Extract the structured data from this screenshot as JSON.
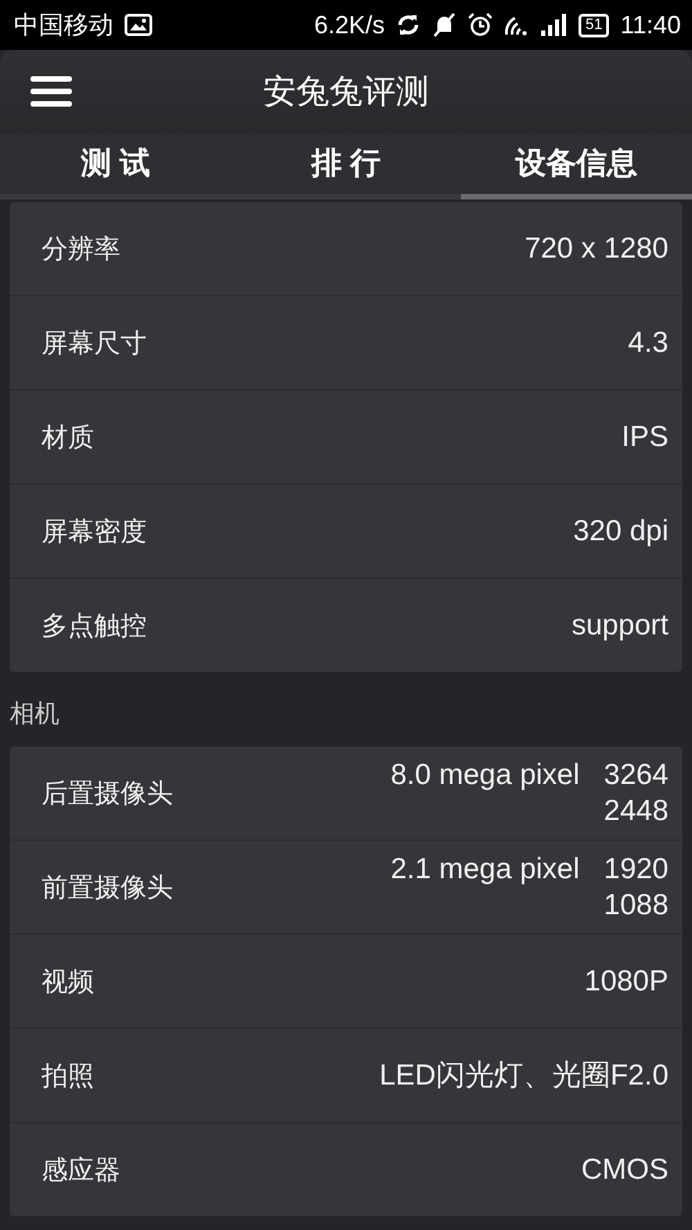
{
  "status_bar": {
    "carrier": "中国移动",
    "speed": "6.2K/s",
    "battery": "51",
    "time": "11:40"
  },
  "app_bar": {
    "title": "安兔兔评测"
  },
  "tabs": [
    {
      "label": "测 试",
      "selected": false
    },
    {
      "label": "排 行",
      "selected": false
    },
    {
      "label": "设备信息",
      "selected": true
    }
  ],
  "sections": [
    {
      "rows": [
        {
          "label": "分辨率",
          "value_lines": [
            "720 x 1280"
          ]
        },
        {
          "label": "屏幕尺寸",
          "value_lines": [
            "4.3"
          ]
        },
        {
          "label": "材质",
          "value_lines": [
            "IPS"
          ]
        },
        {
          "label": "屏幕密度",
          "value_lines": [
            "320 dpi"
          ]
        },
        {
          "label": "多点触控",
          "value_lines": [
            "support"
          ]
        }
      ]
    },
    {
      "heading": "相机",
      "rows": [
        {
          "label": "后置摄像头",
          "value_lines": [
            "8.0 mega pixel   3264",
            "2448"
          ]
        },
        {
          "label": "前置摄像头",
          "value_lines": [
            "2.1 mega pixel   1920",
            "1088"
          ]
        },
        {
          "label": "视频",
          "value_lines": [
            "1080P"
          ]
        },
        {
          "label": "拍照",
          "value_lines": [
            "LED闪光灯、光圈F2.0"
          ]
        },
        {
          "label": "感应器",
          "value_lines": [
            "CMOS"
          ]
        }
      ]
    }
  ]
}
